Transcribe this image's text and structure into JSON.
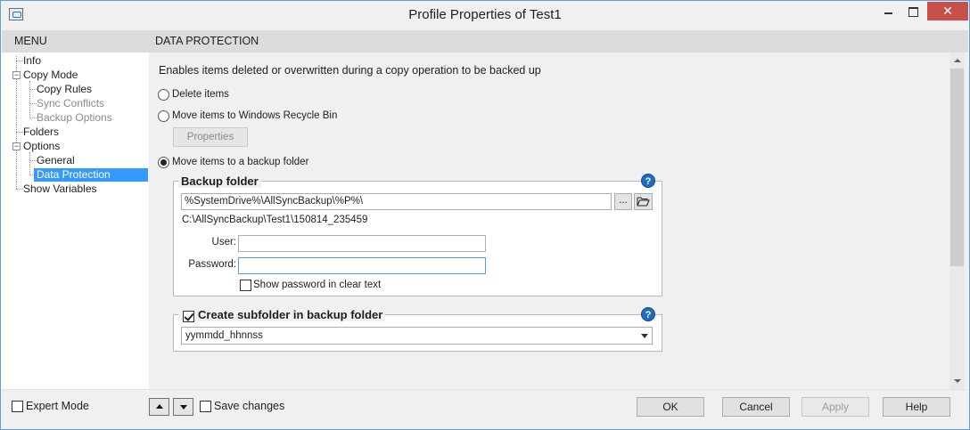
{
  "window": {
    "title": "Profile Properties of Test1"
  },
  "header": {
    "menu_label": "MENU",
    "section_label": "DATA PROTECTION"
  },
  "tree": {
    "items": [
      {
        "label": "Info",
        "state": "normal"
      },
      {
        "label": "Copy Mode",
        "state": "normal",
        "expander": "−"
      },
      {
        "label": "Copy Rules",
        "state": "normal"
      },
      {
        "label": "Sync Conflicts",
        "state": "disabled"
      },
      {
        "label": "Backup Options",
        "state": "disabled"
      },
      {
        "label": "Folders",
        "state": "normal"
      },
      {
        "label": "Options",
        "state": "normal",
        "expander": "−"
      },
      {
        "label": "General",
        "state": "normal"
      },
      {
        "label": "Data Protection",
        "state": "selected"
      },
      {
        "label": "Show Variables",
        "state": "normal"
      }
    ]
  },
  "content": {
    "description": "Enables items deleted or overwritten during a copy operation to be backed up",
    "options": [
      {
        "label": "Delete items",
        "checked": false
      },
      {
        "label": "Move items to Windows Recycle Bin",
        "checked": false
      },
      {
        "label": "Move items to a backup folder",
        "checked": true
      }
    ],
    "properties_button": "Properties",
    "backup_group": {
      "title": "Backup folder",
      "help": "?",
      "path_value": "%SystemDrive%\\AllSyncBackup\\%P%\\",
      "browse_label": "...",
      "folder_icon": "open-folder-icon",
      "resolved_path": "C:\\AllSyncBackup\\Test1\\150814_235459",
      "user_label": "User:",
      "user_value": "",
      "password_label": "Password:",
      "password_value": "",
      "show_password_label": "Show password in clear text",
      "show_password_checked": false
    },
    "subfolder_group": {
      "title": "Create subfolder in backup folder",
      "checked": true,
      "help": "?",
      "format_value": "yymmdd_hhnnss"
    }
  },
  "footer": {
    "expert_mode_label": "Expert Mode",
    "expert_mode_checked": false,
    "save_changes_label": "Save changes",
    "save_changes_checked": false,
    "ok_label": "OK",
    "cancel_label": "Cancel",
    "apply_label": "Apply",
    "help_label": "Help"
  },
  "colors": {
    "selection": "#3399ff",
    "close_button": "#c7504b",
    "help_icon": "#1f6bc2"
  }
}
